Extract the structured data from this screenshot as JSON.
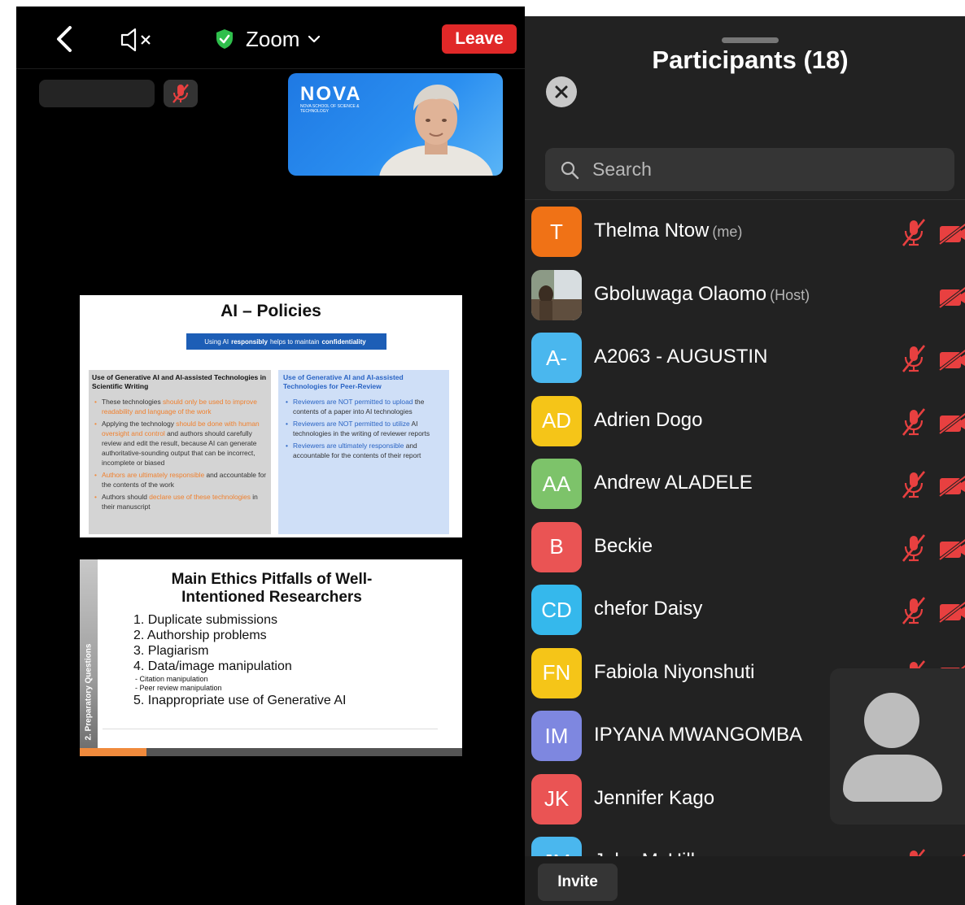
{
  "meeting": {
    "leave_label": "Leave",
    "zoom_label": "Zoom",
    "video_tile": {
      "logo": "NOVA",
      "logo_sub": "NOVA SCHOOL OF SCIENCE & TECHNOLOGY"
    }
  },
  "slide1": {
    "title": "AI – Policies",
    "banner_pre": "Using AI",
    "banner_bold1": "responsibly",
    "banner_mid": "helps to maintain",
    "banner_bold2": "confidentiality",
    "left_heading": "Use of Generative AI and AI-assisted Technologies in Scientific Writing",
    "left_items": [
      {
        "text": "These technologies ",
        "hl": "should only be used to improve readability and language of the work",
        "rest": ""
      },
      {
        "text": "Applying the technology ",
        "hl": "should be done with human oversight and control",
        "rest": " and authors should carefully review and edit the result, because AI can generate authoritative-sounding output that can be incorrect, incomplete or biased"
      },
      {
        "text": "",
        "hl": "Authors are ultimately responsible",
        "rest": " and accountable for the contents of the work"
      },
      {
        "text": "Authors should ",
        "hl": "declare use of these technologies",
        "rest": " in their manuscript"
      }
    ],
    "right_heading": "Use of Generative AI and AI-assisted Technologies for Peer-Review",
    "right_items": [
      {
        "text": "",
        "hl": "Reviewers are NOT permitted to upload",
        "rest": " the contents of a paper into AI technologies"
      },
      {
        "text": "",
        "hl": "Reviewers are NOT permitted to utilize",
        "rest": " AI technologies in the writing of reviewer reports"
      },
      {
        "text": "",
        "hl": "Reviewers are ultimately responsible",
        "rest": " and accountable for the contents of their report"
      }
    ]
  },
  "slide2": {
    "title_line1": "Main Ethics Pitfalls of Well-",
    "title_line2": "Intentioned Researchers",
    "side_label": "2. Preparatory Questions",
    "items": [
      "1.  Duplicate submissions",
      "2.  Authorship problems",
      "3.  Plagiarism",
      "4.  Data/image manipulation"
    ],
    "sub_items": [
      "-   Citation manipulation",
      "-   Peer review manipulation"
    ],
    "last_item": "5.  Inappropriate use of Generative AI"
  },
  "panel": {
    "title": "Participants (18)",
    "search_placeholder": "Search",
    "invite_label": "Invite",
    "participants": [
      {
        "initials": "T",
        "name": "Thelma Ntow",
        "tag": "(me)",
        "color": "#f07216",
        "mic_muted": true
      },
      {
        "initials": "",
        "name": "Gboluwaga Olaomo",
        "tag": "(Host)",
        "color": "#6c7a68",
        "mic_muted": false,
        "photo": true
      },
      {
        "initials": "A-",
        "name": "A2063 - AUGUSTIN",
        "tag": "",
        "color": "#4ab7ee",
        "mic_muted": true
      },
      {
        "initials": "AD",
        "name": "Adrien Dogo",
        "tag": "",
        "color": "#f5c518",
        "mic_muted": true
      },
      {
        "initials": "AA",
        "name": "Andrew ALADELE",
        "tag": "",
        "color": "#7dc36a",
        "mic_muted": true
      },
      {
        "initials": "B",
        "name": "Beckie",
        "tag": "",
        "color": "#ea5454",
        "mic_muted": true
      },
      {
        "initials": "CD",
        "name": "chefor Daisy",
        "tag": "",
        "color": "#35b8ec",
        "mic_muted": true
      },
      {
        "initials": "FN",
        "name": "Fabiola Niyonshuti",
        "tag": "",
        "color": "#f5c518",
        "mic_muted": true
      },
      {
        "initials": "IM",
        "name": "IPYANA MWANGOMBA",
        "tag": "",
        "color": "#7e87e0",
        "mic_muted": true
      },
      {
        "initials": "JK",
        "name": "Jennifer Kago",
        "tag": "",
        "color": "#ea5454",
        "mic_muted": true
      },
      {
        "initials": "JM",
        "name": "John McHill...",
        "tag": "",
        "color": "#4ab7ee",
        "mic_muted": true
      }
    ]
  },
  "colors": {
    "leave": "#e02828",
    "muted_red": "#e84040",
    "panel_bg": "#222222",
    "shield_green": "#2fbf4c"
  }
}
